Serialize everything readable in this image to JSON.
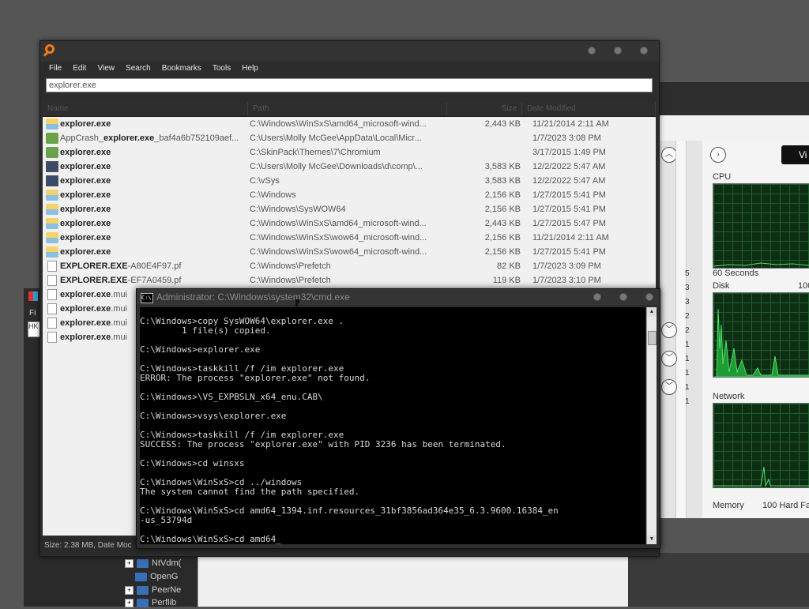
{
  "search_window": {
    "menu": [
      "File",
      "Edit",
      "View",
      "Search",
      "Bookmarks",
      "Tools",
      "Help"
    ],
    "search_value": "explorer.exe",
    "columns": [
      "Name",
      "Path",
      "Size",
      "Date Modified"
    ],
    "rows": [
      {
        "icon": "folder-glass",
        "pre": "",
        "hl": "explorer.exe",
        "post": "",
        "path": "C:\\Windows\\WinSxS\\amd64_microsoft-wind...",
        "size": "2,443 KB",
        "date": "11/21/2014 2:11 AM"
      },
      {
        "icon": "folder",
        "pre": "AppCrash_",
        "hl": "explorer.exe",
        "post": "_baf4a6b752109aef...",
        "path": "C:\\Users\\Molly McGee\\AppData\\Local\\Micr...",
        "size": "",
        "date": "1/7/2023 3:08 PM"
      },
      {
        "icon": "folder",
        "pre": "",
        "hl": "explorer.exe",
        "post": "",
        "path": "C:\\SkinPack\\Themes\\7\\Chromium",
        "size": "",
        "date": "3/17/2015 1:49 PM"
      },
      {
        "icon": "monitor",
        "pre": "",
        "hl": "explorer.exe",
        "post": "",
        "path": "C:\\Users\\Molly McGee\\Downloads\\d\\comp\\...",
        "size": "3,583 KB",
        "date": "12/2/2022 5:47 AM"
      },
      {
        "icon": "monitor",
        "pre": "",
        "hl": "explorer.exe",
        "post": "",
        "path": "C:\\vSys",
        "size": "3,583 KB",
        "date": "12/2/2022 5:47 AM"
      },
      {
        "icon": "folder-glass",
        "pre": "",
        "hl": "explorer.exe",
        "post": "",
        "path": "C:\\Windows",
        "size": "2,156 KB",
        "date": "1/27/2015 5:41 PM"
      },
      {
        "icon": "folder-glass",
        "pre": "",
        "hl": "explorer.exe",
        "post": "",
        "path": "C:\\Windows\\SysWOW64",
        "size": "2,156 KB",
        "date": "1/27/2015 5:41 PM"
      },
      {
        "icon": "folder-glass",
        "pre": "",
        "hl": "explorer.exe",
        "post": "",
        "path": "C:\\Windows\\WinSxS\\amd64_microsoft-wind...",
        "size": "2,443 KB",
        "date": "1/27/2015 5:47 PM"
      },
      {
        "icon": "folder-glass",
        "pre": "",
        "hl": "explorer.exe",
        "post": "",
        "path": "C:\\Windows\\WinSxS\\wow64_microsoft-wind...",
        "size": "2,156 KB",
        "date": "11/21/2014 2:11 AM"
      },
      {
        "icon": "folder-glass",
        "pre": "",
        "hl": "explorer.exe",
        "post": "",
        "path": "C:\\Windows\\WinSxS\\wow64_microsoft-wind...",
        "size": "2,156 KB",
        "date": "1/27/2015 5:41 PM"
      },
      {
        "icon": "doc",
        "pre": "",
        "hl": "EXPLORER.EXE",
        "post": "-A80E4F97.pf",
        "path": "C:\\Windows\\Prefetch",
        "size": "82 KB",
        "date": "1/7/2023 3:09 PM"
      },
      {
        "icon": "doc",
        "pre": "",
        "hl": "EXPLORER.EXE",
        "post": "-EF7A0459.pf",
        "path": "C:\\Windows\\Prefetch",
        "size": "119 KB",
        "date": "1/7/2023 3:10 PM"
      },
      {
        "icon": "doc",
        "pre": "",
        "hl": "explorer.exe",
        "post": ".mui",
        "path": "",
        "size": "",
        "date": ""
      },
      {
        "icon": "doc",
        "pre": "",
        "hl": "explorer.exe",
        "post": ".mui",
        "path": "",
        "size": "",
        "date": ""
      },
      {
        "icon": "doc",
        "pre": "",
        "hl": "explorer.exe",
        "post": ".mui",
        "path": "",
        "size": "",
        "date": ""
      },
      {
        "icon": "doc",
        "pre": "",
        "hl": "explorer.exe",
        "post": ".mui",
        "path": "",
        "size": "",
        "date": ""
      }
    ],
    "status": "Size: 2.38 MB, Date Moc"
  },
  "cmd_window": {
    "title": "Administrator: C:\\Windows\\system32\\cmd.exe",
    "lines": [
      "C:\\Windows>copy SysWOW64\\explorer.exe .",
      "        1 file(s) copied.",
      "",
      "C:\\Windows>explorer.exe",
      "",
      "C:\\Windows>taskkill /f /im explorer.exe",
      "ERROR: The process \"explorer.exe\" not found.",
      "",
      "C:\\Windows>\\VS_EXPBSLN_x64_enu.CAB\\",
      "",
      "C:\\Windows>vsys\\explorer.exe",
      "",
      "C:\\Windows>taskkill /f /im explorer.exe",
      "SUCCESS: The process \"explorer.exe\" with PID 3236 has been terminated.",
      "",
      "C:\\Windows>cd winsxs",
      "",
      "C:\\Windows\\WinSxS>cd ../windows",
      "The system cannot find the path specified.",
      "",
      "C:\\Windows\\WinSxS>cd amd64_1394.inf.resources_31bf3856ad364e35_6.3.9600.16384_en",
      "-us_53794d",
      "",
      "C:\\Windows\\WinSxS>cd amd64_"
    ]
  },
  "task_manager": {
    "view_button": "Vi",
    "cpu_label": "CPU",
    "seconds_label": "60 Seconds",
    "disk_label": "Disk",
    "disk_right": "100",
    "network_label": "Network",
    "memory_label": "Memory",
    "memory_right": "100 Hard Fa",
    "side_numbers": [
      "5",
      "3",
      "3",
      "2",
      "2",
      "1",
      "1",
      "1",
      "1",
      "1"
    ]
  },
  "explorer_tree": {
    "items": [
      "NtVdm(",
      "OpenG",
      "PeerNe",
      "Perflib"
    ],
    "menu_fragment": "Fi",
    "box_fragment": "HK"
  }
}
